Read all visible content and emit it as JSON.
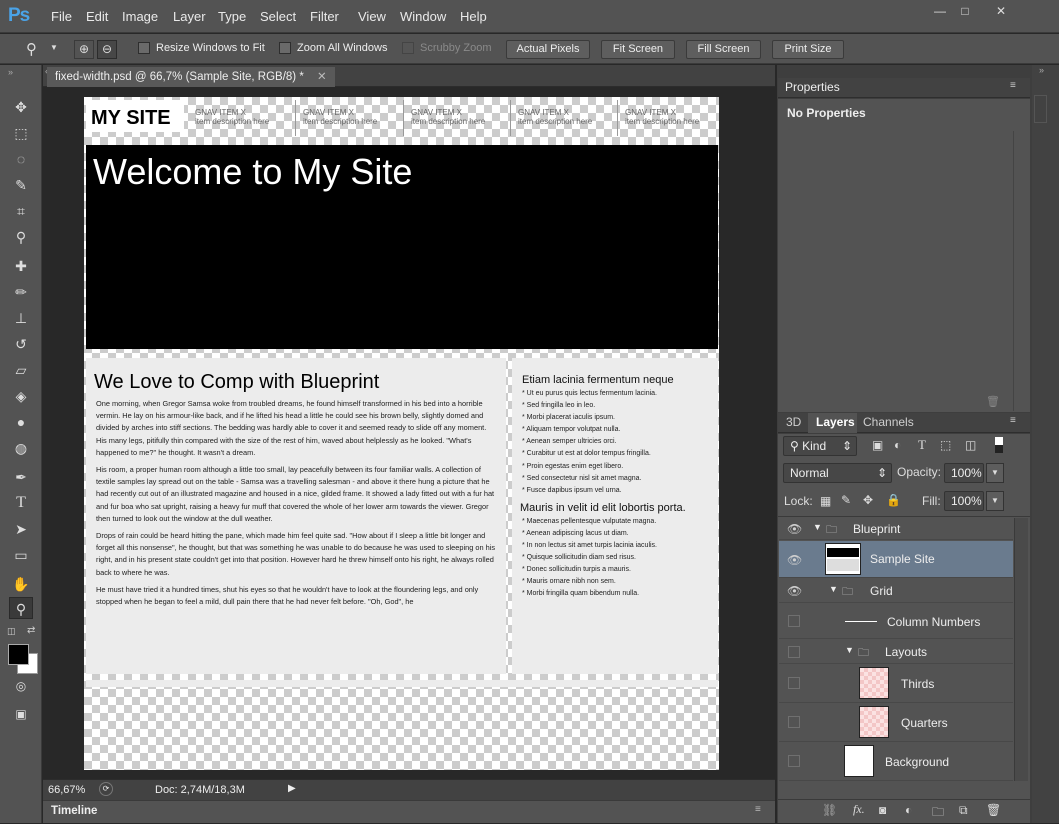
{
  "app": {
    "logo": "Ps"
  },
  "menu": [
    "File",
    "Edit",
    "Image",
    "Layer",
    "Type",
    "Select",
    "Filter",
    "View",
    "Window",
    "Help"
  ],
  "window_controls": {
    "minimize": "—",
    "maximize": "□",
    "close": "✕"
  },
  "options_bar": {
    "resize_windows": "Resize Windows to Fit",
    "zoom_all": "Zoom All Windows",
    "scrubby": "Scrubby Zoom",
    "actual_pixels": "Actual Pixels",
    "fit_screen": "Fit Screen",
    "fill_screen": "Fill Screen",
    "print_size": "Print Size"
  },
  "document": {
    "tab_title": "fixed-width.psd @ 66,7% (Sample Site, RGB/8) *",
    "site": {
      "logo": "MY SITE",
      "nav": [
        {
          "title": "GNAV ITEM X",
          "desc": "item description here"
        },
        {
          "title": "GNAV ITEM X",
          "desc": "item description here"
        },
        {
          "title": "GNAV ITEM X",
          "desc": "item description here"
        },
        {
          "title": "GNAV ITEM X",
          "desc": "item description here"
        },
        {
          "title": "GNAV ITEM X",
          "desc": "item description here"
        }
      ],
      "hero": "Welcome to My Site",
      "main_heading": "We Love to Comp with Blueprint",
      "paragraphs": [
        "One morning, when Gregor Samsa woke from troubled dreams, he found himself transformed in his bed into a horrible vermin. He lay on his armour-like back, and if he lifted his head a little he could see his brown belly, slightly domed and divided by arches into stiff sections. The bedding was hardly able to cover it and seemed ready to slide off any moment. His many legs, pitifully thin compared with the size of the rest of him, waved about helplessly as he looked. \"What's happened to me?\" he thought. It wasn't a dream.",
        "His room, a proper human room although a little too small, lay peacefully between its four familiar walls. A collection of textile samples lay spread out on the table - Samsa was a travelling salesman - and above it there hung a picture that he had recently cut out of an illustrated magazine and housed in a nice, gilded frame. It showed a lady fitted out with a fur hat and fur boa who sat upright, raising a heavy fur muff that covered the whole of her lower arm towards the viewer. Gregor then turned to look out the window at the dull weather.",
        "Drops of rain could be heard hitting the pane, which made him feel quite sad. \"How about if I sleep a little bit longer and forget all this nonsense\", he thought, but that was something he was unable to do because he was used to sleeping on his right, and in his present state couldn't get into that position. However hard he threw himself onto his right, he always rolled back to where he was.",
        "He must have tried it a hundred times, shut his eyes so that he wouldn't have to look at the floundering legs, and only stopped when he began to feel a mild, dull pain there that he had never felt before. \"Oh, God\", he"
      ],
      "side1": {
        "heading": "Etiam lacinia fermentum neque",
        "items": [
          "Ut eu purus quis lectus fermentum lacinia.",
          "Sed fringilla leo in leo.",
          "Morbi placerat iaculis ipsum.",
          "Aliquam tempor volutpat nulla.",
          "Aenean semper ultricies orci.",
          "Curabitur ut est at dolor tempus fringilla.",
          "Proin egestas enim eget libero.",
          "Sed consectetur nisl sit amet magna.",
          "Fusce dapibus ipsum vel urna."
        ]
      },
      "side2": {
        "heading": "Mauris in velit id elit lobortis porta.",
        "items": [
          "Maecenas pellentesque vulputate magna.",
          "Aenean adipiscing lacus ut diam.",
          "In non lectus sit amet turpis lacinia iaculis.",
          "Quisque sollicitudin diam sed risus.",
          "Donec sollicitudin turpis a mauris.",
          "Mauris ornare nibh non sem.",
          "Morbi fringilla quam bibendum nulla."
        ]
      }
    }
  },
  "status": {
    "zoom": "66,67%",
    "doc": "Doc: 2,74M/18,3M"
  },
  "timeline_label": "Timeline",
  "properties_panel": {
    "title": "Properties",
    "content": "No Properties"
  },
  "layers_panel": {
    "tabs": [
      "3D",
      "Layers",
      "Channels"
    ],
    "filter": "Kind",
    "blend_mode": "Normal",
    "opacity_label": "Opacity:",
    "opacity_value": "100%",
    "lock_label": "Lock:",
    "fill_label": "Fill:",
    "fill_value": "100%",
    "layers": [
      {
        "name": "Blueprint",
        "kind": "group",
        "visible": true
      },
      {
        "name": "Sample Site",
        "kind": "layer",
        "visible": true,
        "selected": true
      },
      {
        "name": "Grid",
        "kind": "group",
        "visible": true
      },
      {
        "name": "Column Numbers",
        "kind": "layer",
        "visible": false
      },
      {
        "name": "Layouts",
        "kind": "group",
        "visible": false
      },
      {
        "name": "Thirds",
        "kind": "layer",
        "visible": false
      },
      {
        "name": "Quarters",
        "kind": "layer",
        "visible": false
      },
      {
        "name": "Background",
        "kind": "layer",
        "visible": false
      }
    ]
  }
}
